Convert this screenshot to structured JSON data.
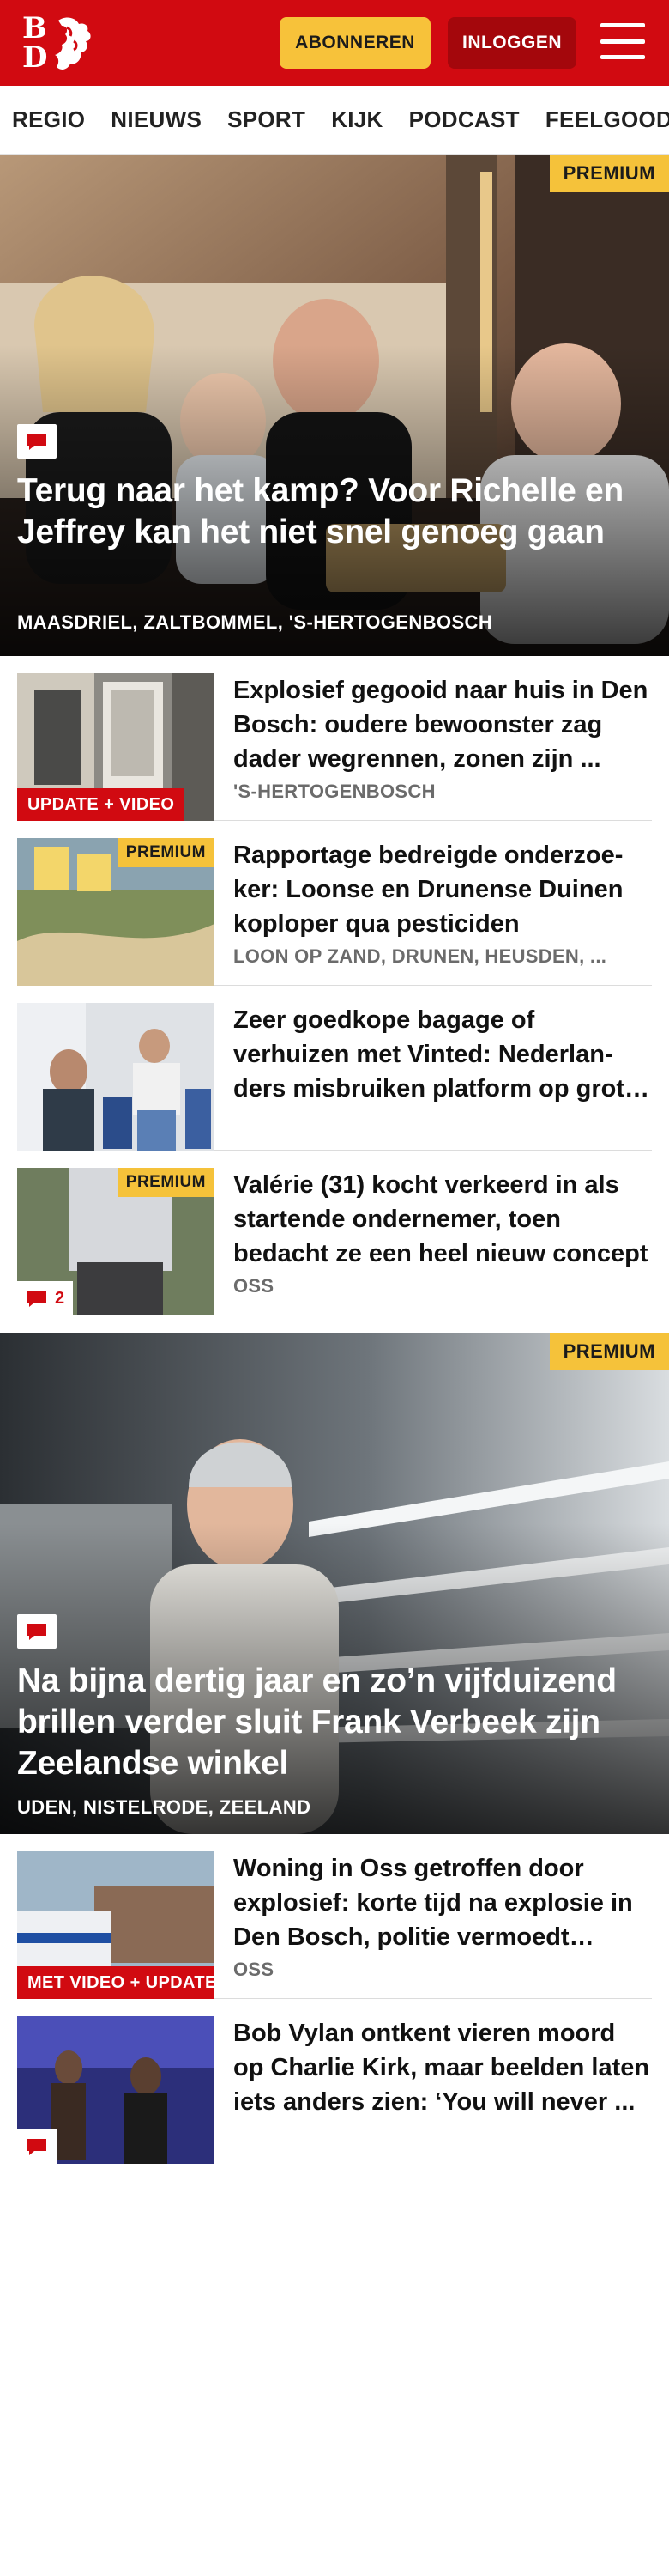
{
  "header": {
    "logo_text": [
      "B",
      "D"
    ],
    "subscribe_label": "ABONNEREN",
    "login_label": "INLOGGEN",
    "brand_color": "#d10a11",
    "accent_color": "#f5c23a"
  },
  "nav": {
    "items": [
      {
        "label": "REGIO"
      },
      {
        "label": "NIEUWS"
      },
      {
        "label": "SPORT"
      },
      {
        "label": "KIJK"
      },
      {
        "label": "PODCAST"
      },
      {
        "label": "FEELGOOD"
      }
    ],
    "overflow_indicator": "I"
  },
  "hero1": {
    "badge": "PREMIUM",
    "icon": "comment-icon",
    "title": "Terug naar het kamp? Voor Richelle en Jeffrey kan het niet snel genoeg gaan",
    "locations": "MAASDRIEL, ZALTBOMMEL, 'S-HERTOGENBOSCH"
  },
  "list1": [
    {
      "label": "UPDATE + VIDEO",
      "title": "Explosief gegooid naar huis in Den Bosch: oudere bewoonster zag dader wegrennen, zonen zijn ...",
      "location": "'S-HERTOGENBOSCH"
    },
    {
      "badge": "PREMIUM",
      "title": "Rapportage bedreigde onderzoe­ker: Loonse en Drunense Duinen koploper qua pesticiden",
      "location": "LOON OP ZAND, DRUNEN, HEUSDEN, ..."
    },
    {
      "title": "Zeer goedkope bagage of verhuizen met Vinted: Nederlan­ders misbruiken platform op grote schaal",
      "location": ""
    },
    {
      "badge": "PREMIUM",
      "comments": "2",
      "title": "Valérie (31) kocht verkeerd in als startende ondernemer, toen bedacht ze een heel nieuw concept",
      "location": "OSS"
    }
  ],
  "hero2": {
    "badge": "PREMIUM",
    "icon": "comment-icon",
    "title": "Na bijna dertig jaar en zo’n vijfduizend brillen verder sluit Frank Verbeek zijn Zeelandse winkel",
    "locations": "UDEN, NISTELRODE, ZEELAND"
  },
  "list2": [
    {
      "label": "MET VIDEO + UPDATE",
      "title": "Woning in Oss getroffen door explosief: korte tijd na explosie in Den Bosch, politie vermoedt verband",
      "location": "OSS"
    },
    {
      "title": "Bob Vylan ontkent vieren moord op Charlie Kirk, maar beelden laten iets anders zien: ‘You will never ...",
      "location": ""
    }
  ]
}
